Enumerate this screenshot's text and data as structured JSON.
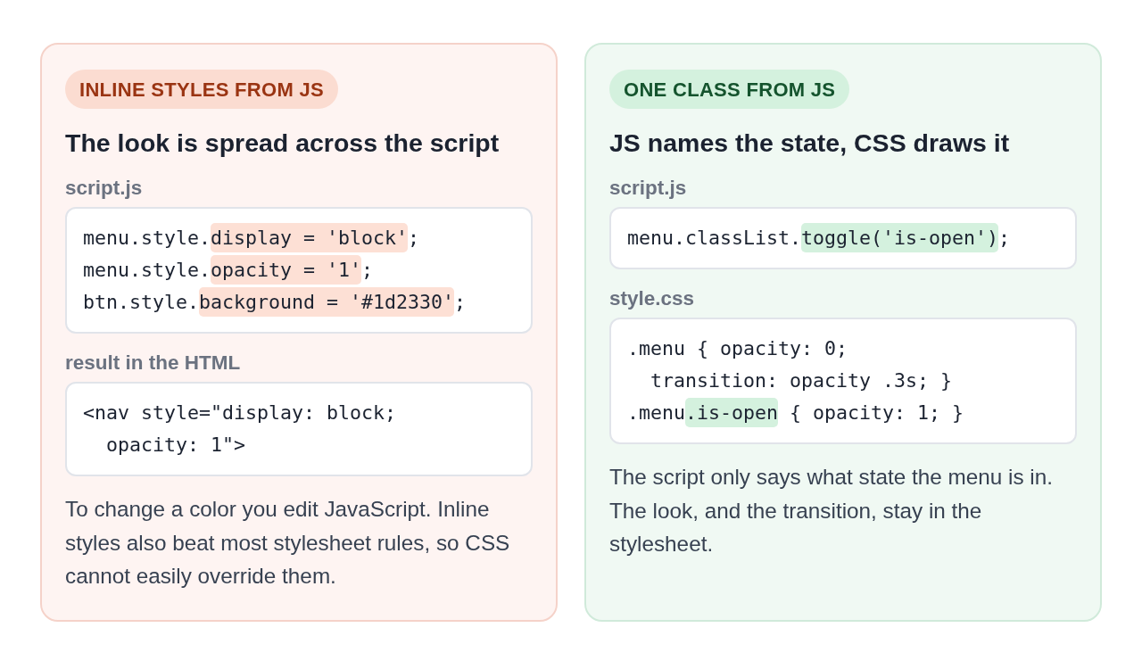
{
  "cards": [
    {
      "kind": "inline",
      "badge": "INLINE STYLES FROM JS",
      "heading": "The look is spread across the script",
      "sections": [
        {
          "label": "script.js",
          "lines": [
            {
              "segments": [
                {
                  "text": "menu.style.",
                  "highlighted": false
                },
                {
                  "text": "display = 'block'",
                  "highlighted": true
                },
                {
                  "text": ";",
                  "highlighted": false
                }
              ]
            },
            {
              "segments": [
                {
                  "text": "menu.style.",
                  "highlighted": false
                },
                {
                  "text": "opacity = '1'",
                  "highlighted": true
                },
                {
                  "text": ";",
                  "highlighted": false
                }
              ]
            },
            {
              "segments": [
                {
                  "text": "btn.style.",
                  "highlighted": false
                },
                {
                  "text": "background = '#1d2330'",
                  "highlighted": true
                },
                {
                  "text": ";",
                  "highlighted": false
                }
              ]
            }
          ]
        },
        {
          "label": "result in the HTML",
          "lines": [
            {
              "segments": [
                {
                  "text": "<nav style=\"display: block;",
                  "highlighted": false
                }
              ]
            },
            {
              "segments": [
                {
                  "text": "  opacity: 1\">",
                  "highlighted": false
                }
              ]
            }
          ]
        }
      ],
      "note": "To change a color you edit JavaScript. Inline styles also beat most stylesheet rules, so CSS cannot easily override them."
    },
    {
      "kind": "class",
      "badge": "ONE CLASS FROM JS",
      "heading": "JS names the state, CSS draws it",
      "sections": [
        {
          "label": "script.js",
          "lines": [
            {
              "segments": [
                {
                  "text": "menu.classList.",
                  "highlighted": false
                },
                {
                  "text": "toggle('is-open')",
                  "highlighted": true
                },
                {
                  "text": ";",
                  "highlighted": false
                }
              ]
            }
          ]
        },
        {
          "label": "style.css",
          "lines": [
            {
              "segments": [
                {
                  "text": ".menu { opacity: 0;",
                  "highlighted": false
                }
              ]
            },
            {
              "segments": [
                {
                  "text": "  transition: opacity .3s; }",
                  "highlighted": false
                }
              ]
            },
            {
              "segments": [
                {
                  "text": ".menu",
                  "highlighted": false
                },
                {
                  "text": ".is-open",
                  "highlighted": true
                },
                {
                  "text": " { opacity: 1; }",
                  "highlighted": false
                }
              ]
            }
          ]
        }
      ],
      "note": "The script only says what state the menu is in. The look, and the transition, stay in the stylesheet."
    }
  ]
}
